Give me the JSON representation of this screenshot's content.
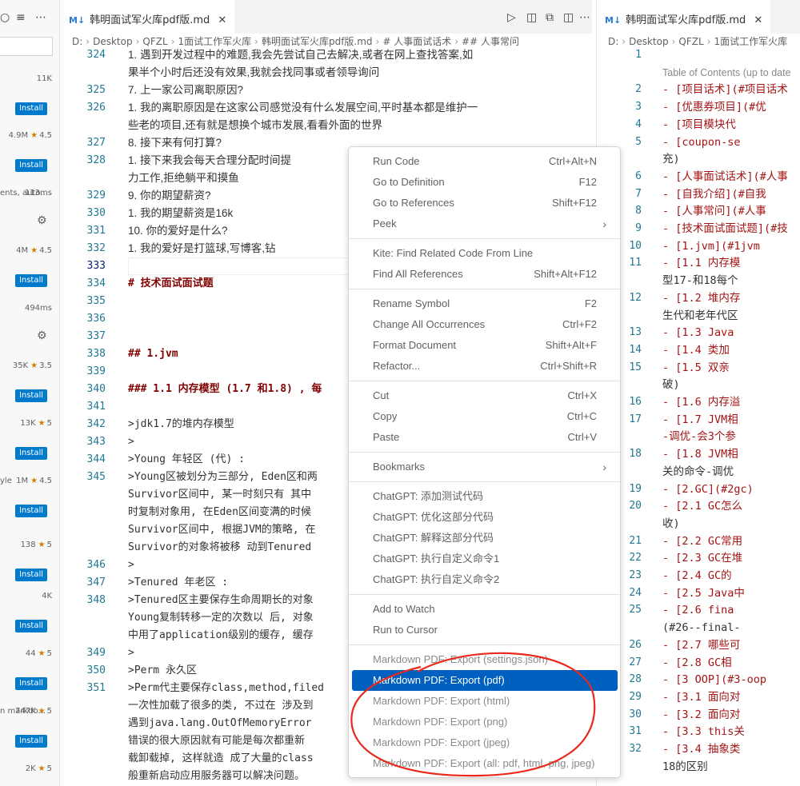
{
  "ext_sidebar": {
    "entries": [
      {
        "meta": "11K",
        "star": "",
        "rating": "",
        "cut": "",
        "install": "Install"
      },
      {
        "meta": "4.9M",
        "star": "★",
        "rating": "4.5",
        "cut": "",
        "install": "Install"
      },
      {
        "meta": "113ms",
        "star": "",
        "rating": "",
        "cut": "ents, auto...",
        "install": ""
      },
      {
        "meta": "4M",
        "star": "★",
        "rating": "4.5",
        "cut": "",
        "install": "Install"
      },
      {
        "meta": "494ms",
        "star": "",
        "rating": "",
        "cut": "",
        "install": ""
      },
      {
        "meta": "35K",
        "star": "★",
        "rating": "3.5",
        "cut": "",
        "install": "Install"
      },
      {
        "meta": "13K",
        "star": "★",
        "rating": "5",
        "cut": "",
        "install": "Install"
      },
      {
        "meta": "1M",
        "star": "★",
        "rating": "4.5",
        "cut": "yle",
        "install": "Install"
      },
      {
        "meta": "138",
        "star": "★",
        "rating": "5",
        "cut": "",
        "install": "Install"
      },
      {
        "meta": "4K",
        "star": "",
        "rating": "",
        "cut": "",
        "install": "Install"
      },
      {
        "meta": "44",
        "star": "★",
        "rating": "5",
        "cut": "",
        "install": "Install"
      },
      {
        "meta": "747K",
        "star": "★",
        "rating": "5",
        "cut": "n markdo...",
        "install": "Install"
      },
      {
        "meta": "2K",
        "star": "★",
        "rating": "5",
        "cut": "",
        "install": ""
      }
    ]
  },
  "editor1": {
    "tab_icon": "M↓",
    "tab_title": "韩明面试军火库pdf版.md",
    "breadcrumb": [
      "D:",
      "Desktop",
      "QFZL",
      "1面试工作军火库",
      "韩明面试军火库pdf版.md",
      "# 人事面试话术",
      "## 人事常问"
    ],
    "lines": [
      {
        "n": "324",
        "t": "   1. 遇到开发过程中的难题,我会先尝试自己去解决,或者在网上查找答案,如"
      },
      {
        "n": "",
        "t": "   果半个小时后还没有效果,我就会找同事或者领导询问"
      },
      {
        "n": "325",
        "t": "7. 上一家公司离职原因?"
      },
      {
        "n": "326",
        "t": "   1. 我的离职原因是在这家公司感觉没有什么发展空间,平时基本都是维护一"
      },
      {
        "n": "",
        "t": "   些老的项目,还有就是想换个城市发展,看看外面的世界"
      },
      {
        "n": "327",
        "t": "8. 接下来有何打算?"
      },
      {
        "n": "328",
        "t": "   1. 接下来我会每天合理分配时间提"
      },
      {
        "n": "",
        "t": "   力工作,拒绝躺平和摸鱼"
      },
      {
        "n": "329",
        "t": "9. 你的期望薪资?"
      },
      {
        "n": "330",
        "t": "   1. 我的期望薪资是16k"
      },
      {
        "n": "331",
        "t": "10. 你的爱好是什么?"
      },
      {
        "n": "332",
        "t": "    1. 我的爱好是打篮球,写博客,钻"
      },
      {
        "n": "333",
        "t": ""
      },
      {
        "n": "334",
        "t": "# 技术面试面试题"
      },
      {
        "n": "335",
        "t": ""
      },
      {
        "n": "336",
        "t": ""
      },
      {
        "n": "337",
        "t": ""
      },
      {
        "n": "338",
        "t": "## 1.jvm"
      },
      {
        "n": "339",
        "t": ""
      },
      {
        "n": "340",
        "t": "### 1.1 内存模型 (1.7 和1.8) , 每"
      },
      {
        "n": "341",
        "t": ""
      },
      {
        "n": "342",
        "t": ">jdk1.7的堆内存模型"
      },
      {
        "n": "343",
        "t": ">"
      },
      {
        "n": "344",
        "t": ">Young 年轻区 (代) :"
      },
      {
        "n": "345",
        "t": ">Young区被划分为三部分, Eden区和两"
      },
      {
        "n": "",
        "t": "Survivor区间中, 某一时刻只有 其中"
      },
      {
        "n": "",
        "t": "时复制对象用, 在Eden区间变满的时候"
      },
      {
        "n": "",
        "t": "Survivor区间中, 根据JVM的策略, 在"
      },
      {
        "n": "",
        "t": "Survivor的对象将被移 动到Tenured"
      },
      {
        "n": "346",
        "t": ">"
      },
      {
        "n": "347",
        "t": ">Tenured 年老区 :"
      },
      {
        "n": "348",
        "t": ">Tenured区主要保存生命周期长的对象"
      },
      {
        "n": "",
        "t": "Young复制转移一定的次数以 后, 对象"
      },
      {
        "n": "",
        "t": "中用了application级别的缓存, 缓存"
      },
      {
        "n": "349",
        "t": ">"
      },
      {
        "n": "350",
        "t": ">Perm 永久区"
      },
      {
        "n": "351",
        "t": ">Perm代主要保存class,method,filed"
      },
      {
        "n": "",
        "t": "一次性加载了很多的类, 不过在 涉及到"
      },
      {
        "n": "",
        "t": "遇到java.lang.OutOfMemoryError"
      },
      {
        "n": "",
        "t": "错误的很大原因就有可能是每次都重新"
      },
      {
        "n": "",
        "t": "载卸载掉, 这样就造 成了大量的class"
      },
      {
        "n": "",
        "t": "般重新启动应用服务器可以解决问题。"
      }
    ]
  },
  "editor2": {
    "tab_icon": "M↓",
    "tab_title": "韩明面试军火库pdf版.md",
    "breadcrumb": [
      "D:",
      "Desktop",
      "QFZL",
      "1面试工作军火库"
    ],
    "lines": [
      {
        "n": "1",
        "t": ""
      },
      {
        "n": "",
        "t": "Table of Contents (up to date"
      },
      {
        "n": "2",
        "t": "- [项目话术](#项目话术"
      },
      {
        "n": "3",
        "t": "  - [优惠券项目](#优"
      },
      {
        "n": "4",
        "t": "    - [项目模块代"
      },
      {
        "n": "5",
        "t": "    - [coupon-se"
      },
      {
        "n": "",
        "t": "    充)"
      },
      {
        "n": "6",
        "t": "- [人事面试话术](#人事"
      },
      {
        "n": "7",
        "t": "  - [自我介绍](#自我"
      },
      {
        "n": "8",
        "t": "  - [人事常问](#人事"
      },
      {
        "n": "9",
        "t": "- [技术面试面试题](#技"
      },
      {
        "n": "10",
        "t": "  - [1.jvm](#1jvm"
      },
      {
        "n": "11",
        "t": "    - [1.1 内存模"
      },
      {
        "n": "",
        "t": "    型17-和18每个"
      },
      {
        "n": "12",
        "t": "    - [1.2 堆内存"
      },
      {
        "n": "",
        "t": "    生代和老年代区"
      },
      {
        "n": "13",
        "t": "    - [1.3  Java"
      },
      {
        "n": "14",
        "t": "    - [1.4  类加"
      },
      {
        "n": "15",
        "t": "    - [1.5  双亲"
      },
      {
        "n": "",
        "t": "    破)"
      },
      {
        "n": "16",
        "t": "    - [1.6 内存溢"
      },
      {
        "n": "17",
        "t": "    - [1.7 JVM相"
      },
      {
        "n": "",
        "t": "    -调优-会3个参"
      },
      {
        "n": "18",
        "t": "    - [1.8  JVM相"
      },
      {
        "n": "",
        "t": "    关的命令-调优"
      },
      {
        "n": "19",
        "t": "  - [2.GC](#2gc)"
      },
      {
        "n": "20",
        "t": "    - [2.1 GC怎么"
      },
      {
        "n": "",
        "t": "    收)"
      },
      {
        "n": "21",
        "t": "    - [2.2 GC常用"
      },
      {
        "n": "22",
        "t": "    - [2.3 GC在堆"
      },
      {
        "n": "23",
        "t": "    - [2.4  GC的"
      },
      {
        "n": "24",
        "t": "    - [2.5 Java中"
      },
      {
        "n": "25",
        "t": "    - [2.6  fina"
      },
      {
        "n": "",
        "t": "    (#26--final-"
      },
      {
        "n": "26",
        "t": "    - [2.7 哪些可"
      },
      {
        "n": "27",
        "t": "    - [2.8  GC相"
      },
      {
        "n": "28",
        "t": "  - [3 OOP](#3-oop"
      },
      {
        "n": "29",
        "t": "    - [3.1 面向对"
      },
      {
        "n": "30",
        "t": "    - [3.2 面向对"
      },
      {
        "n": "31",
        "t": "    - [3.3 this关"
      },
      {
        "n": "32",
        "t": "    - [3.4 抽象类"
      },
      {
        "n": "",
        "t": "    18的区别"
      }
    ]
  },
  "context_menu": {
    "groups": [
      [
        {
          "label": "Run Code",
          "shortcut": "Ctrl+Alt+N"
        },
        {
          "label": "Go to Definition",
          "shortcut": "F12"
        },
        {
          "label": "Go to References",
          "shortcut": "Shift+F12"
        },
        {
          "label": "Peek",
          "shortcut": "",
          "submenu": true
        }
      ],
      [
        {
          "label": "Kite: Find Related Code From Line",
          "shortcut": ""
        },
        {
          "label": "Find All References",
          "shortcut": "Shift+Alt+F12"
        }
      ],
      [
        {
          "label": "Rename Symbol",
          "shortcut": "F2"
        },
        {
          "label": "Change All Occurrences",
          "shortcut": "Ctrl+F2"
        },
        {
          "label": "Format Document",
          "shortcut": "Shift+Alt+F"
        },
        {
          "label": "Refactor...",
          "shortcut": "Ctrl+Shift+R"
        }
      ],
      [
        {
          "label": "Cut",
          "shortcut": "Ctrl+X"
        },
        {
          "label": "Copy",
          "shortcut": "Ctrl+C"
        },
        {
          "label": "Paste",
          "shortcut": "Ctrl+V"
        }
      ],
      [
        {
          "label": "Bookmarks",
          "shortcut": "",
          "submenu": true
        }
      ],
      [
        {
          "label": "ChatGPT: 添加测试代码",
          "shortcut": ""
        },
        {
          "label": "ChatGPT: 优化这部分代码",
          "shortcut": ""
        },
        {
          "label": "ChatGPT: 解释这部分代码",
          "shortcut": ""
        },
        {
          "label": "ChatGPT: 执行自定义命令1",
          "shortcut": ""
        },
        {
          "label": "ChatGPT: 执行自定义命令2",
          "shortcut": ""
        }
      ],
      [
        {
          "label": "Add to Watch",
          "shortcut": ""
        },
        {
          "label": "Run to Cursor",
          "shortcut": ""
        }
      ],
      [
        {
          "label": "Markdown PDF: Export (settings.json)",
          "shortcut": ""
        },
        {
          "label": "Markdown PDF: Export (pdf)",
          "shortcut": "",
          "highlighted": true
        },
        {
          "label": "Markdown PDF: Export (html)",
          "shortcut": ""
        },
        {
          "label": "Markdown PDF: Export (png)",
          "shortcut": ""
        },
        {
          "label": "Markdown PDF: Export (jpeg)",
          "shortcut": ""
        },
        {
          "label": "Markdown PDF: Export (all: pdf, html, png, jpeg)",
          "shortcut": ""
        }
      ]
    ]
  },
  "colors": {
    "accent": "#007acc",
    "menu_highlight": "#0060c0",
    "annotation": "#e8291c",
    "line_number": "#237893",
    "markdown_link": "#a31515"
  }
}
